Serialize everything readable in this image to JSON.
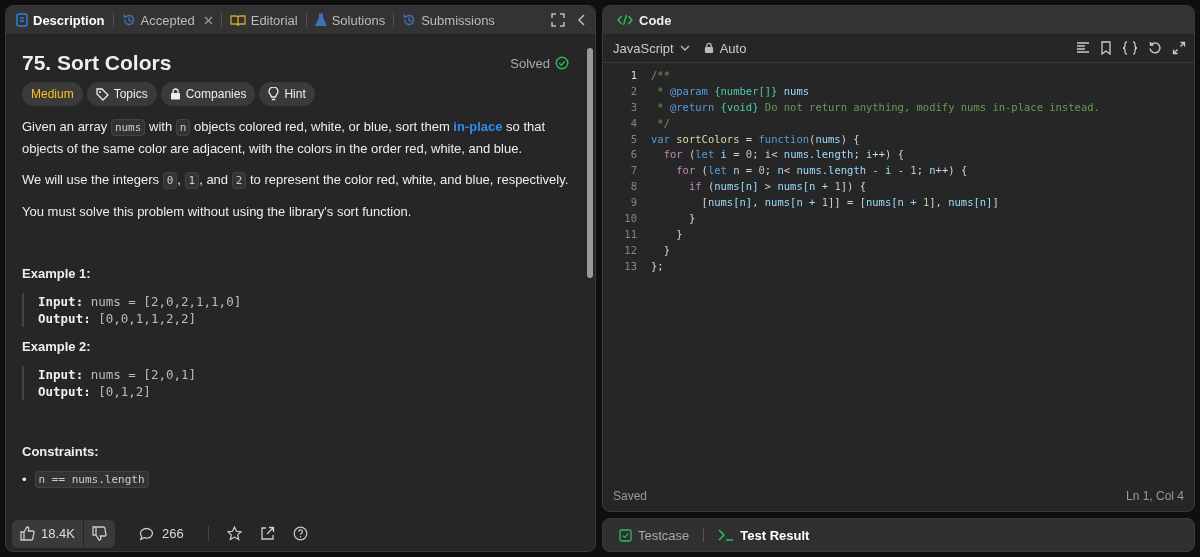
{
  "problem_panel": {
    "tabs": [
      {
        "label": "Description",
        "kind": "description",
        "selected": true,
        "closable": false
      },
      {
        "label": "Accepted",
        "kind": "history",
        "selected": false,
        "closable": true
      },
      {
        "label": "Editorial",
        "kind": "book",
        "selected": false,
        "closable": false
      },
      {
        "label": "Solutions",
        "kind": "flask",
        "selected": false,
        "closable": false
      },
      {
        "label": "Submissions",
        "kind": "history",
        "selected": false,
        "closable": false
      }
    ],
    "title": "75. Sort Colors",
    "status": "Solved",
    "tags": [
      {
        "label": "Medium",
        "kind": "difficulty"
      },
      {
        "label": "Topics",
        "kind": "tag"
      },
      {
        "label": "Companies",
        "kind": "lock"
      },
      {
        "label": "Hint",
        "kind": "bulb"
      }
    ],
    "paragraphs": [
      [
        {
          "text": "Given an array ",
          "kind": "text"
        },
        {
          "text": "nums",
          "kind": "code"
        },
        {
          "text": " with ",
          "kind": "text"
        },
        {
          "text": "n",
          "kind": "code"
        },
        {
          "text": " objects colored red, white, or blue, sort them ",
          "kind": "text"
        },
        {
          "text": "in-place",
          "kind": "link"
        },
        {
          "text": " so that objects of the same color are adjacent, with the colors in the order red, white, and blue.",
          "kind": "text"
        }
      ],
      [
        {
          "text": "We will use the integers ",
          "kind": "text"
        },
        {
          "text": "0",
          "kind": "code"
        },
        {
          "text": ", ",
          "kind": "text"
        },
        {
          "text": "1",
          "kind": "code"
        },
        {
          "text": ", and ",
          "kind": "text"
        },
        {
          "text": "2",
          "kind": "code"
        },
        {
          "text": " to represent the color red, white, and blue, respectively.",
          "kind": "text"
        }
      ],
      [
        {
          "text": "You must solve this problem without using the library's sort function.",
          "kind": "text"
        }
      ]
    ],
    "examples": [
      {
        "title": "Example 1:",
        "lines": [
          {
            "label": "Input:",
            "value": "nums = [2,0,2,1,1,0]"
          },
          {
            "label": "Output:",
            "value": "[0,0,1,1,2,2]"
          }
        ]
      },
      {
        "title": "Example 2:",
        "lines": [
          {
            "label": "Input:",
            "value": "nums = [2,0,1]"
          },
          {
            "label": "Output:",
            "value": "[0,1,2]"
          }
        ]
      }
    ],
    "constraints_title": "Constraints:",
    "constraints": [
      {
        "bullet": "•",
        "code": "n == nums.length"
      }
    ],
    "footer": {
      "likes": "18.4K",
      "comments": "266"
    }
  },
  "code_panel": {
    "title": "Code",
    "language": "JavaScript",
    "mode": "Auto",
    "lines": [
      {
        "number": "1",
        "tokens": [
          {
            "text": "/**",
            "kind": "comment"
          }
        ]
      },
      {
        "number": "2",
        "tokens": [
          {
            "text": " * ",
            "kind": "comment"
          },
          {
            "text": "@param",
            "kind": "tag"
          },
          {
            "text": " {number[]}",
            "kind": "type"
          },
          {
            "text": " nums",
            "kind": "var"
          }
        ]
      },
      {
        "number": "3",
        "tokens": [
          {
            "text": " * ",
            "kind": "comment"
          },
          {
            "text": "@return",
            "kind": "tag"
          },
          {
            "text": " {void}",
            "kind": "type"
          },
          {
            "text": " Do not return anything, modify nums in-place instead.",
            "kind": "comment"
          }
        ]
      },
      {
        "number": "4",
        "tokens": [
          {
            "text": " */",
            "kind": "comment"
          }
        ]
      },
      {
        "number": "5",
        "tokens": [
          {
            "text": "var",
            "kind": "keyword"
          },
          {
            "text": " sortColors",
            "kind": "func"
          },
          {
            "text": " = ",
            "kind": "plain"
          },
          {
            "text": "function",
            "kind": "keyword"
          },
          {
            "text": "(",
            "kind": "plain"
          },
          {
            "text": "nums",
            "kind": "var"
          },
          {
            "text": ") {",
            "kind": "plain"
          }
        ]
      },
      {
        "number": "6",
        "tokens": [
          {
            "text": "  for",
            "kind": "control"
          },
          {
            "text": " (",
            "kind": "plain"
          },
          {
            "text": "let",
            "kind": "keyword"
          },
          {
            "text": " i",
            "kind": "var"
          },
          {
            "text": " = ",
            "kind": "plain"
          },
          {
            "text": "0",
            "kind": "number"
          },
          {
            "text": "; ",
            "kind": "plain"
          },
          {
            "text": "i",
            "kind": "var"
          },
          {
            "text": "< ",
            "kind": "plain"
          },
          {
            "text": "nums.length",
            "kind": "var"
          },
          {
            "text": "; ",
            "kind": "plain"
          },
          {
            "text": "i",
            "kind": "var"
          },
          {
            "text": "++) {",
            "kind": "plain"
          }
        ]
      },
      {
        "number": "7",
        "tokens": [
          {
            "text": "    for",
            "kind": "control"
          },
          {
            "text": " (",
            "kind": "plain"
          },
          {
            "text": "let",
            "kind": "keyword"
          },
          {
            "text": " n",
            "kind": "var"
          },
          {
            "text": " = ",
            "kind": "plain"
          },
          {
            "text": "0",
            "kind": "number"
          },
          {
            "text": "; ",
            "kind": "plain"
          },
          {
            "text": "n",
            "kind": "var"
          },
          {
            "text": "< ",
            "kind": "plain"
          },
          {
            "text": "nums.length",
            "kind": "var"
          },
          {
            "text": " - ",
            "kind": "plain"
          },
          {
            "text": "i",
            "kind": "var"
          },
          {
            "text": " - ",
            "kind": "plain"
          },
          {
            "text": "1",
            "kind": "number"
          },
          {
            "text": "; ",
            "kind": "plain"
          },
          {
            "text": "n",
            "kind": "var"
          },
          {
            "text": "++) {",
            "kind": "plain"
          }
        ]
      },
      {
        "number": "8",
        "tokens": [
          {
            "text": "      if",
            "kind": "control"
          },
          {
            "text": " (",
            "kind": "plain"
          },
          {
            "text": "nums[n]",
            "kind": "var"
          },
          {
            "text": " > ",
            "kind": "plain"
          },
          {
            "text": "nums[n + ",
            "kind": "var"
          },
          {
            "text": "1",
            "kind": "number"
          },
          {
            "text": "]) {",
            "kind": "plain"
          }
        ]
      },
      {
        "number": "9",
        "tokens": [
          {
            "text": "        [",
            "kind": "plain"
          },
          {
            "text": "nums[n], nums[n + ",
            "kind": "var"
          },
          {
            "text": "1",
            "kind": "number"
          },
          {
            "text": "]] = [",
            "kind": "plain"
          },
          {
            "text": "nums[n + ",
            "kind": "var"
          },
          {
            "text": "1",
            "kind": "number"
          },
          {
            "text": "], ",
            "kind": "plain"
          },
          {
            "text": "nums[n]",
            "kind": "var"
          },
          {
            "text": "]",
            "kind": "plain"
          }
        ]
      },
      {
        "number": "10",
        "tokens": [
          {
            "text": "      }",
            "kind": "plain"
          }
        ]
      },
      {
        "number": "11",
        "tokens": [
          {
            "text": "    }",
            "kind": "plain"
          }
        ]
      },
      {
        "number": "12",
        "tokens": [
          {
            "text": "  }",
            "kind": "plain"
          }
        ]
      },
      {
        "number": "13",
        "tokens": [
          {
            "text": "};",
            "kind": "plain"
          }
        ]
      }
    ],
    "save_status": "Saved",
    "cursor_position": "Ln 1, Col 4"
  },
  "bottom_tabs": [
    {
      "label": "Testcase",
      "kind": "testcase",
      "selected": false
    },
    {
      "label": "Test Result",
      "kind": "result",
      "selected": true
    }
  ]
}
